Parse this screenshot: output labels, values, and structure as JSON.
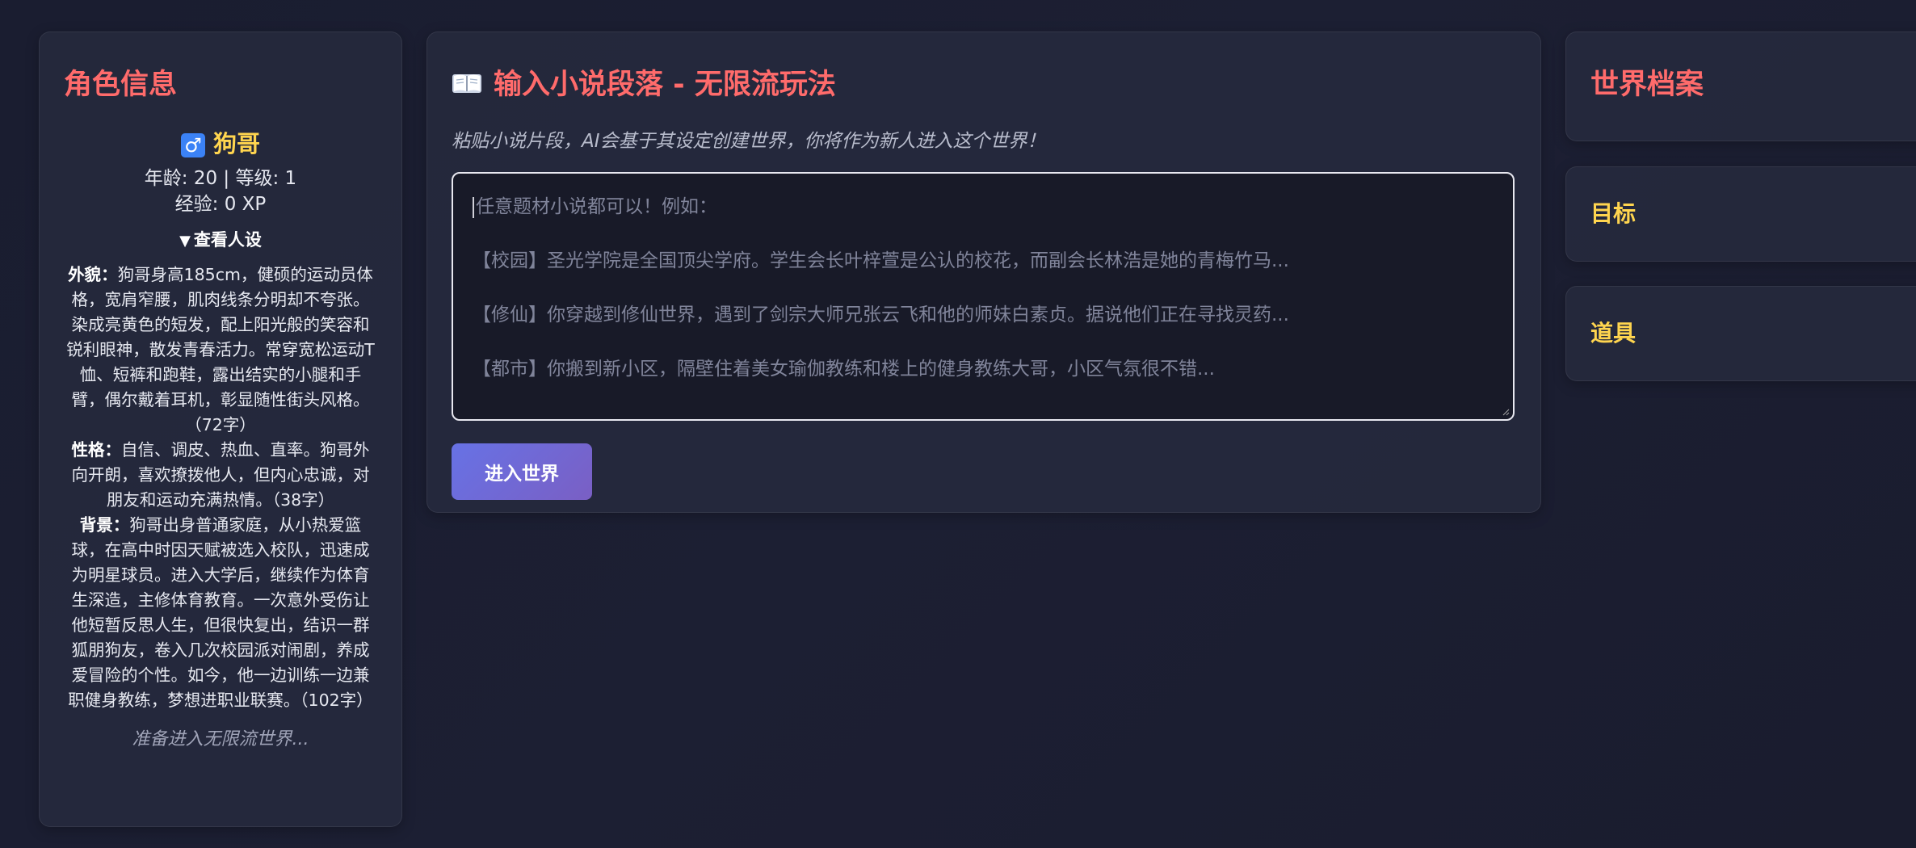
{
  "character": {
    "panel_title": "角色信息",
    "gender_icon": "♂",
    "name": "狗哥",
    "stats": "年龄: 20 | 等级: 1",
    "xp": "经验: 0 XP",
    "toggle_label": "查看人设",
    "appearance_label": "外貌：",
    "appearance": "狗哥身高185cm，健硕的运动员体格，宽肩窄腰，肌肉线条分明却不夸张。染成亮黄色的短发，配上阳光般的笑容和锐利眼神，散发青春活力。常穿宽松运动T恤、短裤和跑鞋，露出结实的小腿和手臂，偶尔戴着耳机，彰显随性街头风格。（72字）",
    "personality_label": "性格：",
    "personality": "自信、调皮、热血、直率。狗哥外向开朗，喜欢撩拨他人，但内心忠诚，对朋友和运动充满热情。（38字）",
    "background_label": "背景：",
    "background": "狗哥出身普通家庭，从小热爱篮球，在高中时因天赋被选入校队，迅速成为明星球员。进入大学后，继续作为体育生深造，主修体育教育。一次意外受伤让他短暂反思人生，但很快复出，结识一群狐朋狗友，卷入几次校园派对闹剧，养成爱冒险的个性。如今，他一边训练一边兼职健身教练，梦想进职业联赛。（102字）",
    "status": "准备进入无限流世界..."
  },
  "input_panel": {
    "title": "输入小说段落 - 无限流玩法",
    "subtitle": "粘贴小说片段，AI会基于其设定创建世界，你将作为新人进入这个世界！",
    "placeholder_lines": [
      "任意题材小说都可以！例如：",
      "【校园】圣光学院是全国顶尖学府。学生会长叶梓萱是公认的校花，而副会长林浩是她的青梅竹马...",
      "【修仙】你穿越到修仙世界，遇到了剑宗大师兄张云飞和他的师妹白素贞。据说他们正在寻找灵药...",
      "【都市】你搬到新小区，隔壁住着美女瑜伽教练和楼上的健身教练大哥，小区气氛很不错..."
    ],
    "enter_button": "进入世界"
  },
  "right": {
    "world_title": "世界档案",
    "goals_title": "目标",
    "items_title": "道具"
  },
  "colors": {
    "title_red": "#ff6b6b",
    "accent_yellow": "#ffd54f",
    "button_gradient_start": "#6772e5",
    "button_gradient_end": "#7a5fc4"
  },
  "icons": {
    "gender": "male-icon",
    "title": "open-book-icon"
  }
}
